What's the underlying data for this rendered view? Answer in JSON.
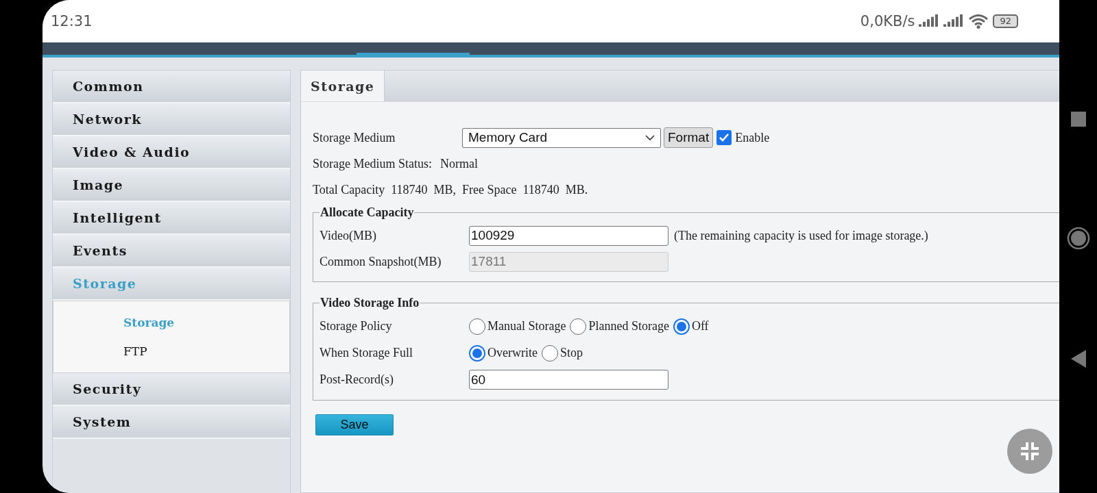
{
  "status_bar": {
    "time": "12:31",
    "net_speed": "0,0KB/s",
    "battery": "92"
  },
  "sidebar": {
    "items": [
      {
        "label": "Common",
        "selected": false
      },
      {
        "label": "Network",
        "selected": false
      },
      {
        "label": "Video & Audio",
        "selected": false
      },
      {
        "label": "Image",
        "selected": false
      },
      {
        "label": "Intelligent",
        "selected": false
      },
      {
        "label": "Events",
        "selected": false
      },
      {
        "label": "Storage",
        "selected": true,
        "children": [
          {
            "label": "Storage",
            "selected": true
          },
          {
            "label": "FTP",
            "selected": false
          }
        ]
      },
      {
        "label": "Security",
        "selected": false
      },
      {
        "label": "System",
        "selected": false
      }
    ]
  },
  "tabs": [
    {
      "label": "Storage",
      "selected": true
    }
  ],
  "storage_medium": {
    "label": "Storage Medium",
    "value": "Memory Card",
    "format_button": "Format",
    "enable": {
      "label": "Enable",
      "checked": true
    }
  },
  "medium_status": {
    "label": "Storage Medium Status:",
    "value": "Normal"
  },
  "capacity_text": "Total Capacity  118740  MB,  Free Space  118740  MB.",
  "allocate_capacity": {
    "title": "Allocate Capacity",
    "rows": [
      {
        "label": "Video(MB)",
        "value": "100929",
        "disabled": false,
        "note": "(The remaining capacity is used for image storage.)"
      },
      {
        "label": "Common Snapshot(MB)",
        "value": "17811",
        "disabled": true
      }
    ]
  },
  "video_storage_info": {
    "title": "Video Storage Info",
    "rows": [
      {
        "kind": "radio",
        "label": "Storage Policy",
        "options": [
          {
            "label": "Manual Storage",
            "selected": false
          },
          {
            "label": "Planned Storage",
            "selected": false
          },
          {
            "label": "Off",
            "selected": true
          }
        ]
      },
      {
        "kind": "radio",
        "label": "When Storage Full",
        "options": [
          {
            "label": "Overwrite",
            "selected": true
          },
          {
            "label": "Stop",
            "selected": false
          }
        ]
      },
      {
        "kind": "input",
        "label": "Post-Record(s)",
        "value": "60"
      }
    ]
  },
  "save_button": "Save"
}
